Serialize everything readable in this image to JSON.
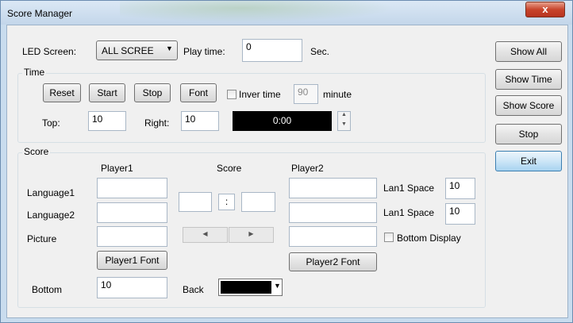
{
  "window": {
    "title": "Score Manager",
    "close_glyph": "x"
  },
  "top": {
    "led_label": "LED Screen:",
    "led_value": "ALL SCREE",
    "playtime_label": "Play time:",
    "playtime_value": "0",
    "sec_label": "Sec."
  },
  "time": {
    "title": "Time",
    "reset": "Reset",
    "start": "Start",
    "stop": "Stop",
    "font": "Font",
    "inver_label": "Inver time",
    "inver_value": "90",
    "minute_label": "minute",
    "top_label": "Top:",
    "top_value": "10",
    "right_label": "Right:",
    "right_value": "10",
    "clock": "0:00"
  },
  "score": {
    "title": "Score",
    "player1_header": "Player1",
    "score_header": "Score",
    "player2_header": "Player2",
    "language1_label": "Language1",
    "language2_label": "Language2",
    "picture_label": "Picture",
    "colon": ":",
    "lan1_space_label_a": "Lan1 Space",
    "lan1_space_value_a": "10",
    "lan1_space_label_b": "Lan1 Space",
    "lan1_space_value_b": "10",
    "bottom_display_label": "Bottom Display",
    "player1_font": "Player1 Font",
    "player2_font": "Player2 Font",
    "bottom_label": "Bottom",
    "bottom_value": "10",
    "back_label": "Back",
    "back_color": "#000000"
  },
  "side": {
    "show_all": "Show All",
    "show_time": "Show Time",
    "show_score": "Show Score",
    "stop": "Stop",
    "exit": "Exit"
  }
}
